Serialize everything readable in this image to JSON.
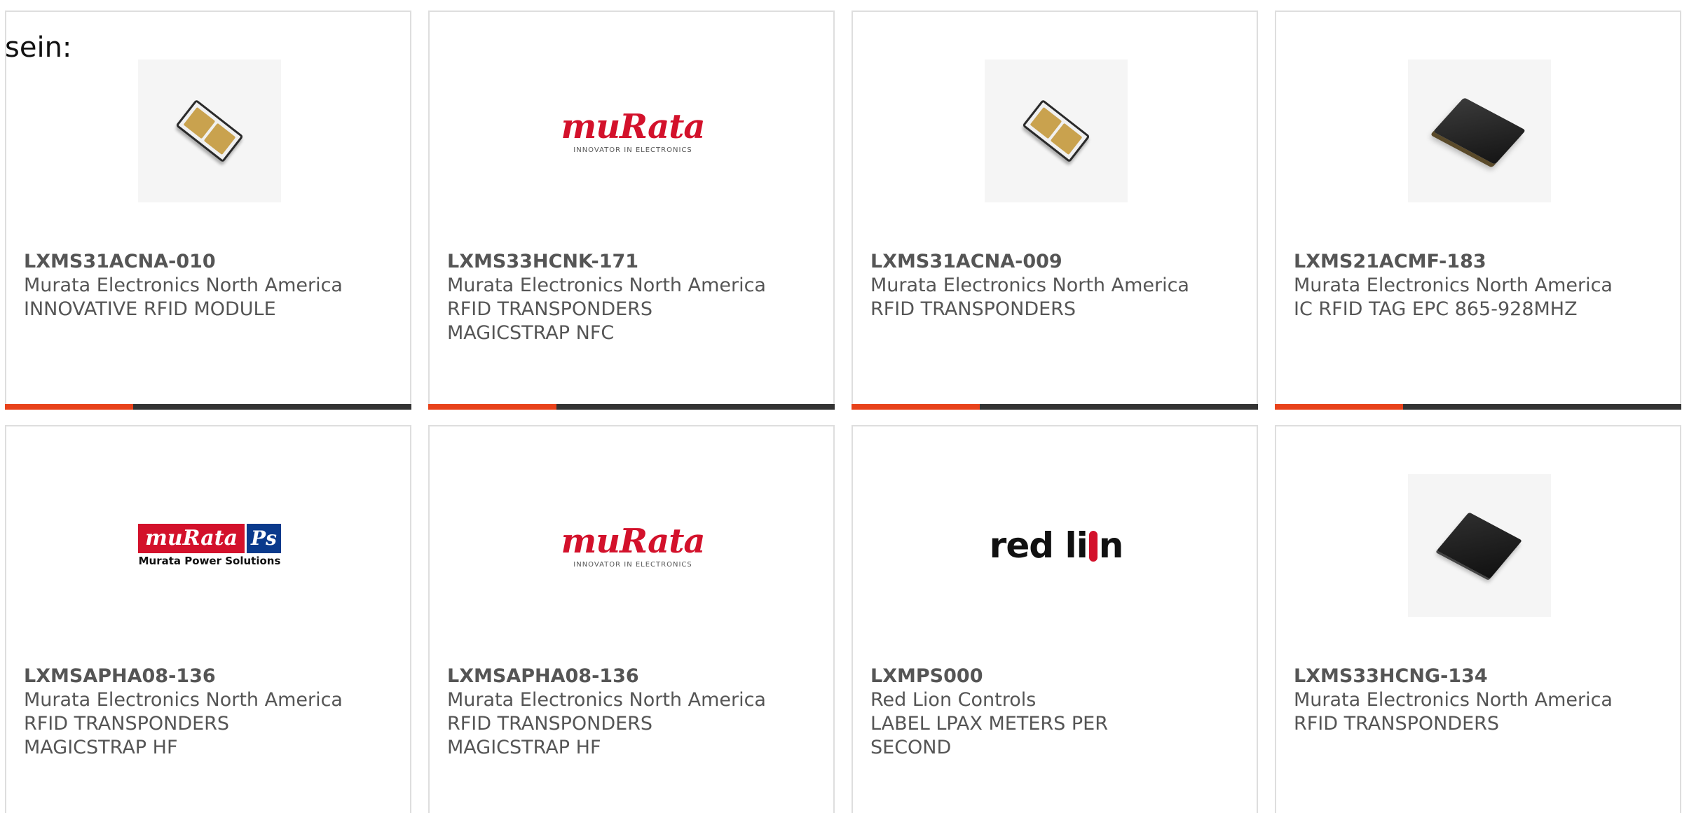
{
  "intro_text": "sein:",
  "colors": {
    "accent": "#e8421b",
    "bar": "#333333",
    "border": "#dedede",
    "text": "#555555",
    "murata_red": "#d3112b",
    "murata_ps_blue": "#0a3a8c"
  },
  "products": [
    {
      "part": "LXMS31ACNA-010",
      "manufacturer": "Murata Electronics North America",
      "desc1": "INNOVATIVE RFID MODULE",
      "desc2": "",
      "image": "chip-tan"
    },
    {
      "part": "LXMS33HCNK-171",
      "manufacturer": "Murata Electronics North America",
      "desc1": "RFID TRANSPONDERS",
      "desc2": "MAGICSTRAP NFC",
      "image": "murata-logo",
      "logo_word": "muRata",
      "logo_tag": "INNOVATOR IN ELECTRONICS"
    },
    {
      "part": "LXMS31ACNA-009",
      "manufacturer": "Murata Electronics North America",
      "desc1": "RFID TRANSPONDERS",
      "desc2": "",
      "image": "chip-tan"
    },
    {
      "part": "LXMS21ACMF-183",
      "manufacturer": "Murata Electronics North America",
      "desc1": "IC RFID TAG EPC 865-928MHZ",
      "desc2": "",
      "image": "chip-black"
    },
    {
      "part": "LXMSAPHA08-136",
      "manufacturer": "Murata Electronics North America",
      "desc1": "RFID TRANSPONDERS",
      "desc2": "MAGICSTRAP HF",
      "image": "murata-ps-logo",
      "logo_word": "muRata",
      "logo_ps": "Ps",
      "logo_sub": "Murata Power Solutions"
    },
    {
      "part": "LXMSAPHA08-136",
      "manufacturer": "Murata Electronics North America",
      "desc1": "RFID TRANSPONDERS",
      "desc2": "MAGICSTRAP HF",
      "image": "murata-logo",
      "logo_word": "muRata",
      "logo_tag": "INNOVATOR IN ELECTRONICS"
    },
    {
      "part": "LXMPS000",
      "manufacturer": "Red Lion Controls",
      "desc1": "LABEL LPAX METERS PER",
      "desc2": "SECOND",
      "image": "redlion-logo",
      "logo_left": "red li",
      "logo_right": "n"
    },
    {
      "part": "LXMS33HCNG-134",
      "manufacturer": "Murata Electronics North America",
      "desc1": "RFID TRANSPONDERS",
      "desc2": "",
      "image": "chip-flat"
    }
  ]
}
